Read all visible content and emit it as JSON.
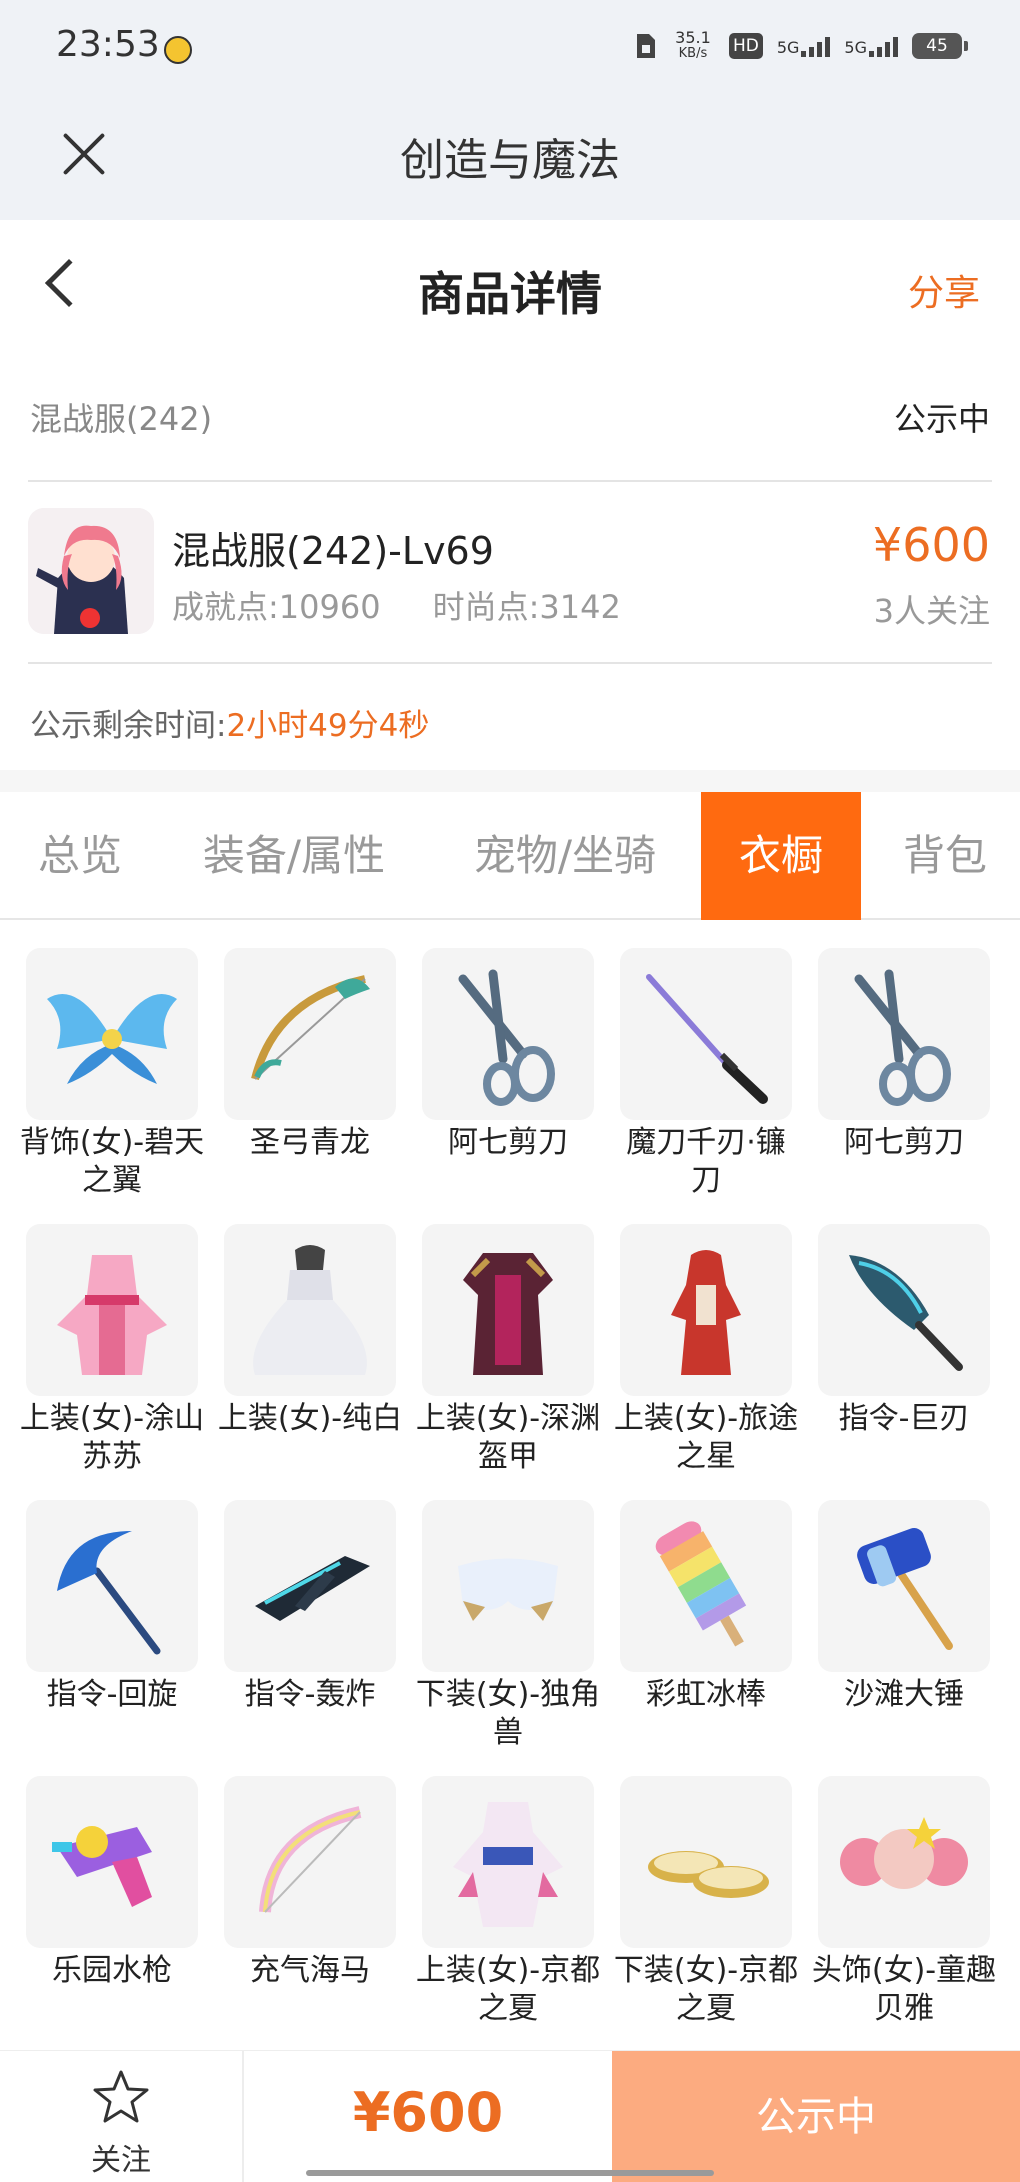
{
  "status_bar": {
    "time": "23:53",
    "speed": "35.1",
    "speed_unit": "KB/s",
    "hd": "HD",
    "network1": "5G",
    "network2": "5G",
    "battery": "45"
  },
  "app_bar": {
    "title": "创造与魔法"
  },
  "nav": {
    "title": "商品详情",
    "share": "分享"
  },
  "server": {
    "name": "混战服(242)",
    "status": "公示中"
  },
  "product": {
    "name": "混战服(242)-Lv69",
    "achievement": "成就点:10960",
    "fashion": "时尚点:3142",
    "price": "¥600",
    "followers": "3人关注"
  },
  "countdown": {
    "label": "公示剩余时间:",
    "value": "2小时49分4秒"
  },
  "tabs": [
    "总览",
    "装备/属性",
    "宠物/坐骑",
    "衣橱",
    "背包"
  ],
  "active_tab": "衣橱",
  "items": [
    {
      "name": "背饰(女)-碧天之翼",
      "icon": "wings-icon"
    },
    {
      "name": "圣弓青龙",
      "icon": "dragon-bow-icon"
    },
    {
      "name": "阿七剪刀",
      "icon": "scissors-icon"
    },
    {
      "name": "魔刀千刃·镰刀",
      "icon": "katana-icon"
    },
    {
      "name": "阿七剪刀",
      "icon": "scissors-icon"
    },
    {
      "name": "上装(女)-涂山苏苏",
      "icon": "pink-dress-icon"
    },
    {
      "name": "上装(女)-纯白",
      "icon": "white-gown-icon"
    },
    {
      "name": "上装(女)-深渊盔甲",
      "icon": "abyss-armor-icon"
    },
    {
      "name": "上装(女)-旅途之星",
      "icon": "red-outfit-icon"
    },
    {
      "name": "指令-巨刃",
      "icon": "giant-blade-icon"
    },
    {
      "name": "指令-回旋",
      "icon": "scythe-icon"
    },
    {
      "name": "指令-轰炸",
      "icon": "bomber-icon"
    },
    {
      "name": "下装(女)-独角兽",
      "icon": "unicorn-pants-icon"
    },
    {
      "name": "彩虹冰棒",
      "icon": "rainbow-popsicle-icon"
    },
    {
      "name": "沙滩大锤",
      "icon": "beach-hammer-icon"
    },
    {
      "name": "乐园水枪",
      "icon": "water-gun-icon"
    },
    {
      "name": "充气海马",
      "icon": "seahorse-bow-icon"
    },
    {
      "name": "上装(女)-京都之夏",
      "icon": "kimono-icon"
    },
    {
      "name": "下装(女)-京都之夏",
      "icon": "sandals-icon"
    },
    {
      "name": "头饰(女)-童趣贝雅",
      "icon": "pink-hair-icon"
    }
  ],
  "bottom_bar": {
    "follow_label": "关注",
    "price": "¥600",
    "status": "公示中"
  },
  "colors": {
    "accent": "#ec6d22",
    "tab_active": "#ff6a10",
    "bottom_status": "#fcab80"
  }
}
